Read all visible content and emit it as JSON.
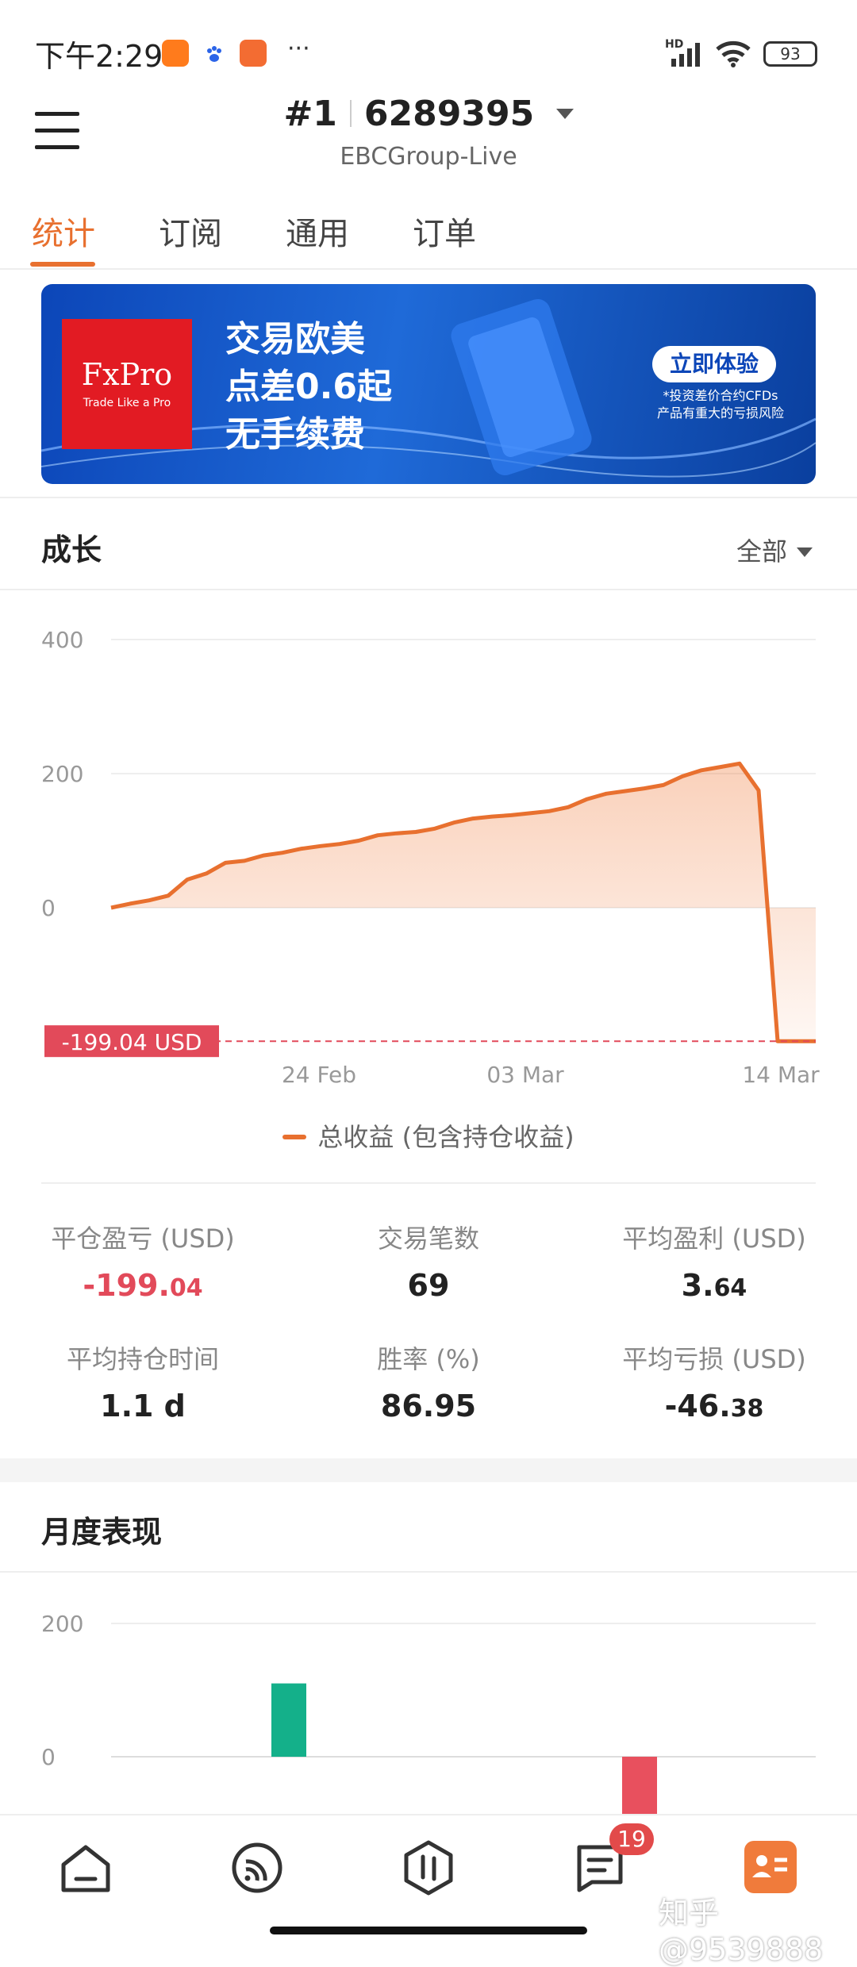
{
  "status_bar": {
    "time": "下午2:29",
    "battery": "93",
    "more": "···",
    "hd": "HD"
  },
  "header": {
    "account_prefix": "#1",
    "account_number": "6289395",
    "server": "EBCGroup-Live"
  },
  "tabs": [
    {
      "label": "统计",
      "active": true
    },
    {
      "label": "订阅",
      "active": false
    },
    {
      "label": "通用",
      "active": false
    },
    {
      "label": "订单",
      "active": false
    }
  ],
  "banner": {
    "brand": "FxPro",
    "tagline": "Trade Like a Pro",
    "lines": [
      "交易欧美",
      "点差0.6起",
      "无手续费"
    ],
    "cta": "立即体验",
    "note_lines": [
      "*投资差价合约CFDs",
      "产品有重大的亏损风险"
    ]
  },
  "growth": {
    "title": "成长",
    "filter": "全部",
    "current_label": "-199.04 USD",
    "legend": "总收益 (包含持仓收益)"
  },
  "chart_data": [
    {
      "type": "area",
      "title": "成长",
      "y_ticks": [
        "400",
        "200",
        "0"
      ],
      "x_ticks": [
        "24 Feb",
        "03 Mar",
        "14 Mar"
      ],
      "ylim": [
        -199.04,
        400
      ],
      "grid": true,
      "series": [
        {
          "name": "总收益 (包含持仓收益)",
          "color": "#e8702f",
          "values": [
            0,
            6,
            11,
            18,
            42,
            51,
            67,
            70,
            78,
            82,
            88,
            92,
            95,
            100,
            108,
            111,
            113,
            118,
            127,
            133,
            136,
            138,
            141,
            144,
            150,
            162,
            170,
            174,
            178,
            183,
            196,
            205,
            210,
            215,
            175,
            -199.04,
            -199.04,
            -199.04
          ]
        }
      ],
      "annotations": [
        "-199.04 USD"
      ]
    },
    {
      "type": "bar",
      "title": "月度表现",
      "y_ticks": [
        "200",
        "0"
      ],
      "ylim": [
        -60,
        200
      ],
      "series": [
        {
          "name": "",
          "values": [
            110,
            -90
          ],
          "colors": [
            "#14b08a",
            "#e8505e"
          ]
        }
      ]
    }
  ],
  "stats": [
    {
      "label": "平仓盈亏 (USD)",
      "value_main": "-199.",
      "value_frac": "04",
      "negative": true
    },
    {
      "label": "交易笔数",
      "value_main": "69",
      "value_frac": "",
      "negative": false
    },
    {
      "label": "平均盈利 (USD)",
      "value_main": "3.",
      "value_frac": "64",
      "negative": false
    },
    {
      "label": "平均持仓时间",
      "value_main": "1.1 d",
      "value_frac": "",
      "negative": false
    },
    {
      "label": "胜率 (%)",
      "value_main": "86.95",
      "value_frac": "",
      "negative": false
    },
    {
      "label": "平均亏损 (USD)",
      "value_main": "-46.",
      "value_frac": "38",
      "negative": false
    }
  ],
  "monthly": {
    "title": "月度表现"
  },
  "nav": {
    "items": [
      "home-icon",
      "signal-icon",
      "trade-icon",
      "messages-icon",
      "profile-icon"
    ],
    "badge": "19",
    "accent": "#f07b3b"
  },
  "watermark": "知乎 @9539888"
}
